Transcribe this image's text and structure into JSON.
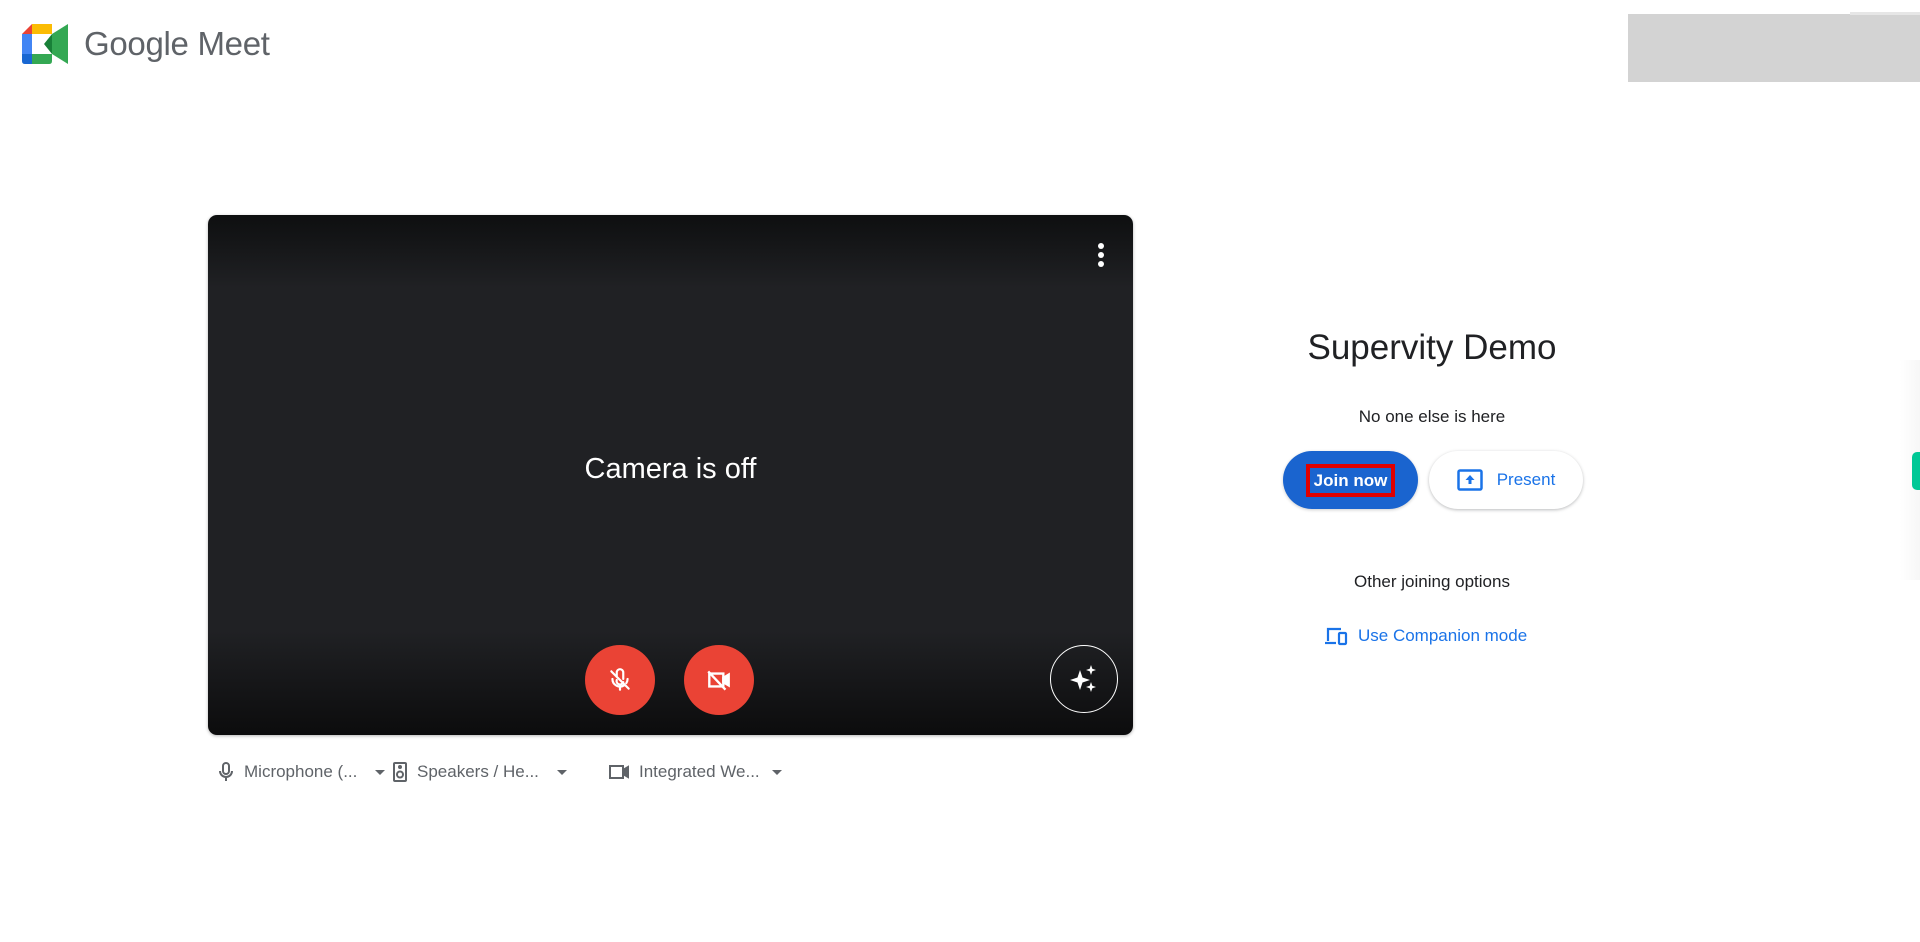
{
  "header": {
    "logo_icon": "google-meet-logo",
    "app_name": "Google Meet"
  },
  "preview": {
    "status_text": "Camera is off",
    "more_options_icon": "more-vert-icon",
    "controls": [
      {
        "name": "microphone",
        "icon": "mic-off-icon",
        "state": "off",
        "color": "#ea4335"
      },
      {
        "name": "camera",
        "icon": "videocam-off-icon",
        "state": "off",
        "color": "#ea4335"
      },
      {
        "name": "visual-effects",
        "icon": "sparkle-icon"
      }
    ]
  },
  "devices": [
    {
      "icon": "microphone-icon",
      "label": "Microphone (..."
    },
    {
      "icon": "speaker-icon",
      "label": "Speakers / He..."
    },
    {
      "icon": "videocam-icon",
      "label": "Integrated We..."
    }
  ],
  "join_panel": {
    "meeting_title": "Supervity Demo",
    "status": "No one else is here",
    "join_button": "Join now",
    "present_button": "Present",
    "present_icon": "present-to-all-icon",
    "other_options_heading": "Other joining options",
    "companion_mode_link": "Use Companion mode",
    "companion_icon": "devices-icon"
  },
  "colors": {
    "primary_blue": "#1a64cf",
    "link_blue": "#1a73e8",
    "danger_red": "#ea4335",
    "highlight_red": "#e00000",
    "edge_tab_green": "#00c896"
  }
}
